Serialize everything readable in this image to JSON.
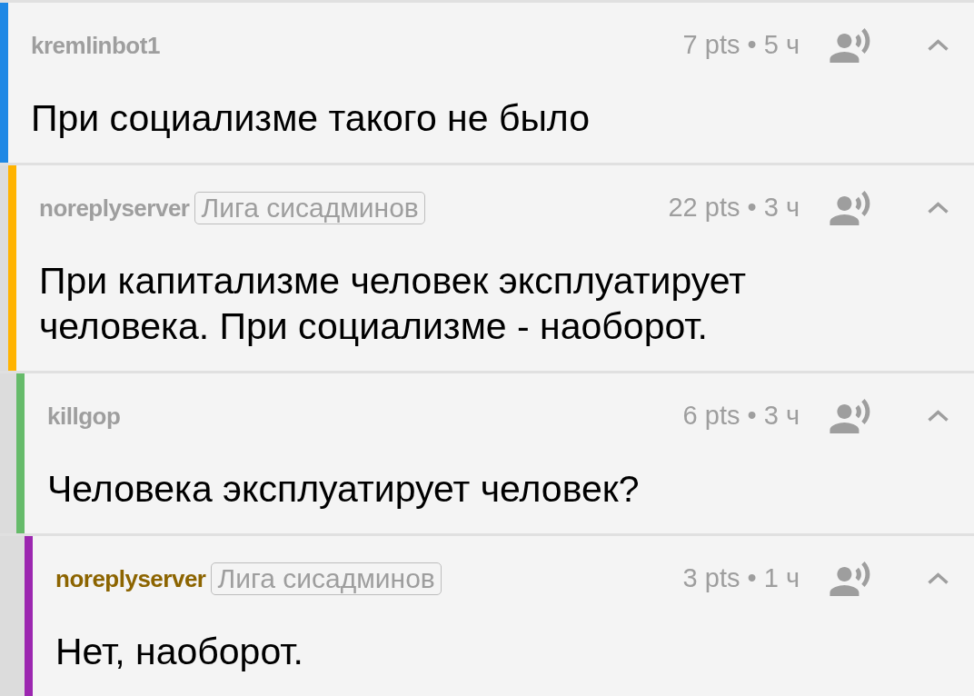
{
  "comments": [
    {
      "author": "kremlinbot1",
      "author_highlighted": false,
      "meta": "7 pts • 5 ч",
      "body": "При социализме такого не было",
      "color": "#1e88e5",
      "children": [
        {
          "author": "noreplyserver",
          "flair": "Лига сисадминов",
          "author_highlighted": false,
          "meta": "22 pts • 3 ч",
          "body": "При капитализме человек эксплуатирует человека. При социализме - наоборот.",
          "color": "#ffb300",
          "children": [
            {
              "author": "killgop",
              "author_highlighted": false,
              "meta": "6 pts • 3 ч",
              "body": "Человека эксплуатирует человек?",
              "color": "#66bb6a",
              "children": [
                {
                  "author": "noreplyserver",
                  "flair": "Лига сисадминов",
                  "author_highlighted": true,
                  "meta": "3 pts • 1 ч",
                  "body": "Нет, наоборот.",
                  "color": "#9c27b0"
                }
              ]
            }
          ]
        }
      ]
    }
  ]
}
